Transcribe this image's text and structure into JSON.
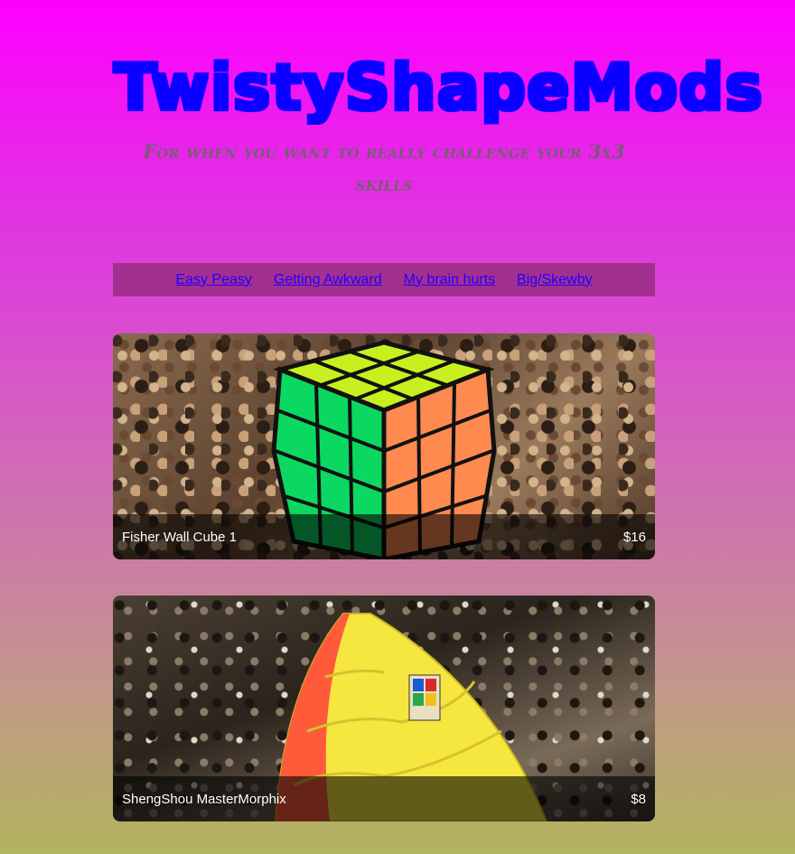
{
  "header": {
    "title": "TwistyShapeMods",
    "tagline": "For when you want to really challenge your 3x3 skills"
  },
  "nav": {
    "items": [
      {
        "label": "Easy Peasy"
      },
      {
        "label": "Getting Awkward"
      },
      {
        "label": "My brain hurts"
      },
      {
        "label": "Big/Skewby"
      }
    ]
  },
  "products": [
    {
      "name": "Fisher Wall Cube 1",
      "price": "$16",
      "image": "fisher-wall-cube-photo"
    },
    {
      "name": "ShengShou MasterMorphix",
      "price": "$8",
      "image": "mastermorphix-photo"
    }
  ],
  "colors": {
    "title": "#0b00ff",
    "nav_bg": "#a3308f",
    "link": "#2000ff",
    "gradient_top": "#ff00ff",
    "gradient_bottom": "#b2b45e"
  }
}
